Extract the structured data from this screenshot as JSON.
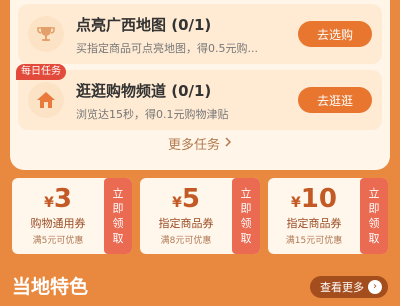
{
  "tasks": [
    {
      "title": "点亮广西地图 (0/1)",
      "desc": "买指定商品可点亮地图，得0.5元购...",
      "button": "去选购",
      "icon": "trophy-icon"
    },
    {
      "badge": "每日任务",
      "title": "逛逛购物频道 (0/1)",
      "desc": "浏览达15秒，得0.1元购物津贴",
      "button": "去逛逛",
      "icon": "home-icon"
    }
  ],
  "more_tasks": "更多任务",
  "coupons": [
    {
      "currency": "¥",
      "amount": "3",
      "name": "购物通用券",
      "condition": "满5元可优惠",
      "claim": [
        "立",
        "即",
        "领",
        "取"
      ]
    },
    {
      "currency": "¥",
      "amount": "5",
      "name": "指定商品券",
      "condition": "满8元可优惠",
      "claim": [
        "立",
        "即",
        "领",
        "取"
      ]
    },
    {
      "currency": "¥",
      "amount": "10",
      "name": "指定商品券",
      "condition": "满15元可优惠",
      "claim": [
        "立",
        "即",
        "领",
        "取"
      ]
    }
  ],
  "local": {
    "title": "当地特色",
    "see_more": "查看更多"
  },
  "colors": {
    "background": "#e9893f",
    "button": "#e8762f",
    "claim": "#ea6a52"
  }
}
